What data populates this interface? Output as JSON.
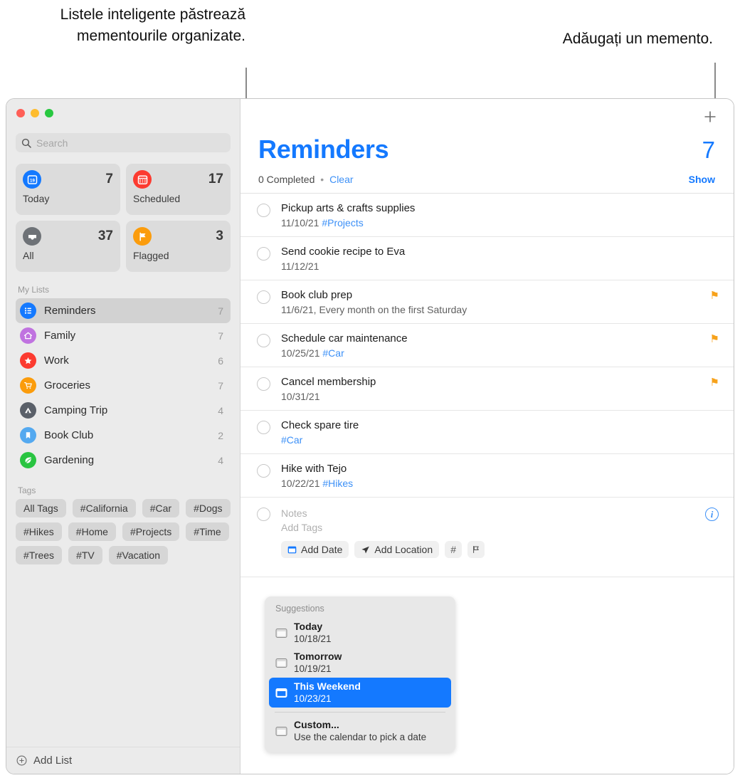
{
  "callouts": {
    "left": "Listele inteligente păstrează mementourile organizate.",
    "right": "Adăugați un memento."
  },
  "sidebar": {
    "search": {
      "placeholder": "Search",
      "icon": "search-icon"
    },
    "smart_lists": [
      {
        "label": "Today",
        "count": "7",
        "icon": "calendar-day-icon",
        "color": "#1479ff",
        "glyph": "19"
      },
      {
        "label": "Scheduled",
        "count": "17",
        "icon": "calendar-icon",
        "color": "#fc3b30"
      },
      {
        "label": "All",
        "count": "37",
        "icon": "inbox-icon",
        "color": "#6e7277"
      },
      {
        "label": "Flagged",
        "count": "3",
        "icon": "flag-icon",
        "color": "#fb9c0c"
      }
    ],
    "my_lists_header": "My Lists",
    "lists": [
      {
        "name": "Reminders",
        "count": "7",
        "color": "#1479ff",
        "icon": "bullet-list-icon",
        "selected": true
      },
      {
        "name": "Family",
        "count": "7",
        "color": "#c濃",
        "icon": "house-icon"
      },
      {
        "name": "Work",
        "count": "6",
        "color": "#fc3b30",
        "icon": "star-icon"
      },
      {
        "name": "Groceries",
        "count": "7",
        "color": "#fb9c0c",
        "icon": "cart-icon"
      },
      {
        "name": "Camping Trip",
        "count": "4",
        "color": "#5a6069",
        "icon": "tent-icon"
      },
      {
        "name": "Book Club",
        "count": "2",
        "color": "#54a9f0",
        "icon": "bookmark-icon"
      },
      {
        "name": "Gardening",
        "count": "4",
        "color": "#29c441",
        "icon": "leaf-icon"
      }
    ],
    "tags_header": "Tags",
    "tags": [
      "All Tags",
      "#California",
      "#Car",
      "#Dogs",
      "#Hikes",
      "#Home",
      "#Projects",
      "#Time",
      "#Trees",
      "#TV",
      "#Vacation"
    ],
    "add_list": {
      "label": "Add List",
      "icon": "plus-circle-icon"
    }
  },
  "main": {
    "add_reminder_icon": "plus-icon",
    "title": "Reminders",
    "count": "7",
    "completed_text": "0 Completed",
    "separator": "•",
    "clear_label": "Clear",
    "show_label": "Show",
    "reminders": [
      {
        "title": "Pickup arts & crafts supplies",
        "date": "11/10/21",
        "tag": "#Projects",
        "flagged": false
      },
      {
        "title": "Send cookie recipe to Eva",
        "date": "11/12/21",
        "tag": "",
        "flagged": false
      },
      {
        "title": "Book club prep",
        "date": "11/6/21, Every month on the first Saturday",
        "tag": "",
        "flagged": true
      },
      {
        "title": "Schedule car maintenance",
        "date": "10/25/21",
        "tag": "#Car",
        "flagged": true
      },
      {
        "title": "Cancel membership",
        "date": "10/31/21",
        "tag": "",
        "flagged": true
      },
      {
        "title": "Check spare tire",
        "date": "",
        "tag": "#Car",
        "flagged": false
      },
      {
        "title": "Hike with Tejo",
        "date": "10/22/21",
        "tag": "#Hikes",
        "flagged": false
      }
    ],
    "editor": {
      "notes_placeholder": "Notes",
      "tags_placeholder": "Add Tags",
      "add_date_label": "Add Date",
      "add_location_label": "Add Location",
      "tag_button_label": "#",
      "flag_button_icon": "flag-outline-icon",
      "info_label": "i"
    },
    "suggestions": {
      "header": "Suggestions",
      "items": [
        {
          "label": "Today",
          "date": "10/18/21",
          "active": false
        },
        {
          "label": "Tomorrow",
          "date": "10/19/21",
          "active": false
        },
        {
          "label": "This Weekend",
          "date": "10/23/21",
          "active": true
        },
        {
          "label": "Custom...",
          "date": "Use the calendar to pick a date",
          "active": false
        }
      ]
    }
  }
}
